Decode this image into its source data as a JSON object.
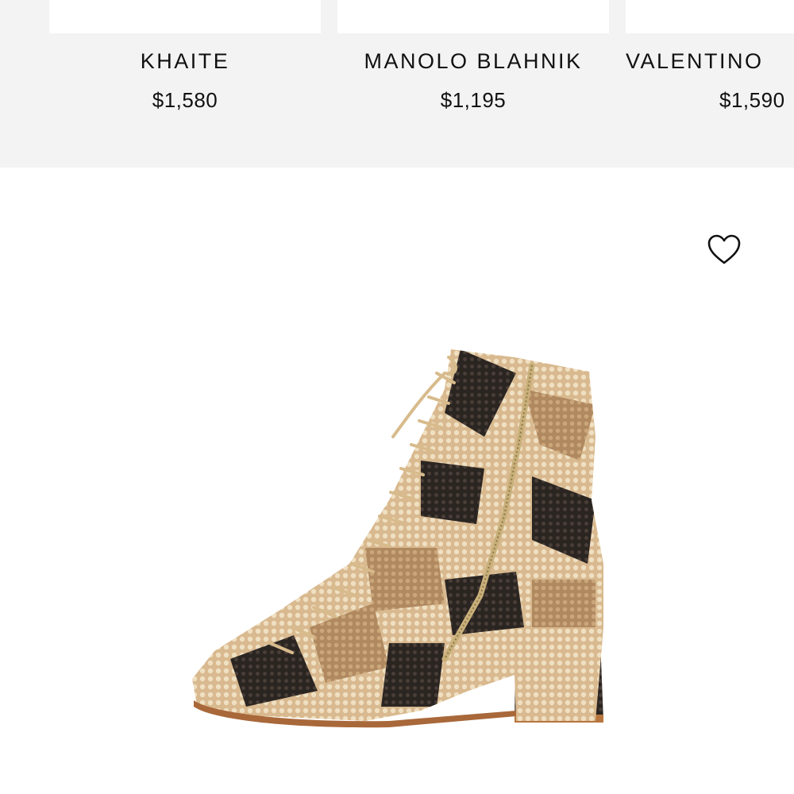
{
  "related_products": [
    {
      "brand": "KHAITE",
      "price": "$1,580"
    },
    {
      "brand": "MANOLO BLAHNIK",
      "price": "$1,195"
    },
    {
      "brand": "VALENTINO",
      "price": "$1,590"
    }
  ],
  "product": {
    "image_subject": "snakeskin lace-up ankle boot",
    "wishlist_icon": "heart-outline-icon"
  },
  "colors": {
    "strip_bg": "#f3f3f3",
    "text": "#111111"
  }
}
